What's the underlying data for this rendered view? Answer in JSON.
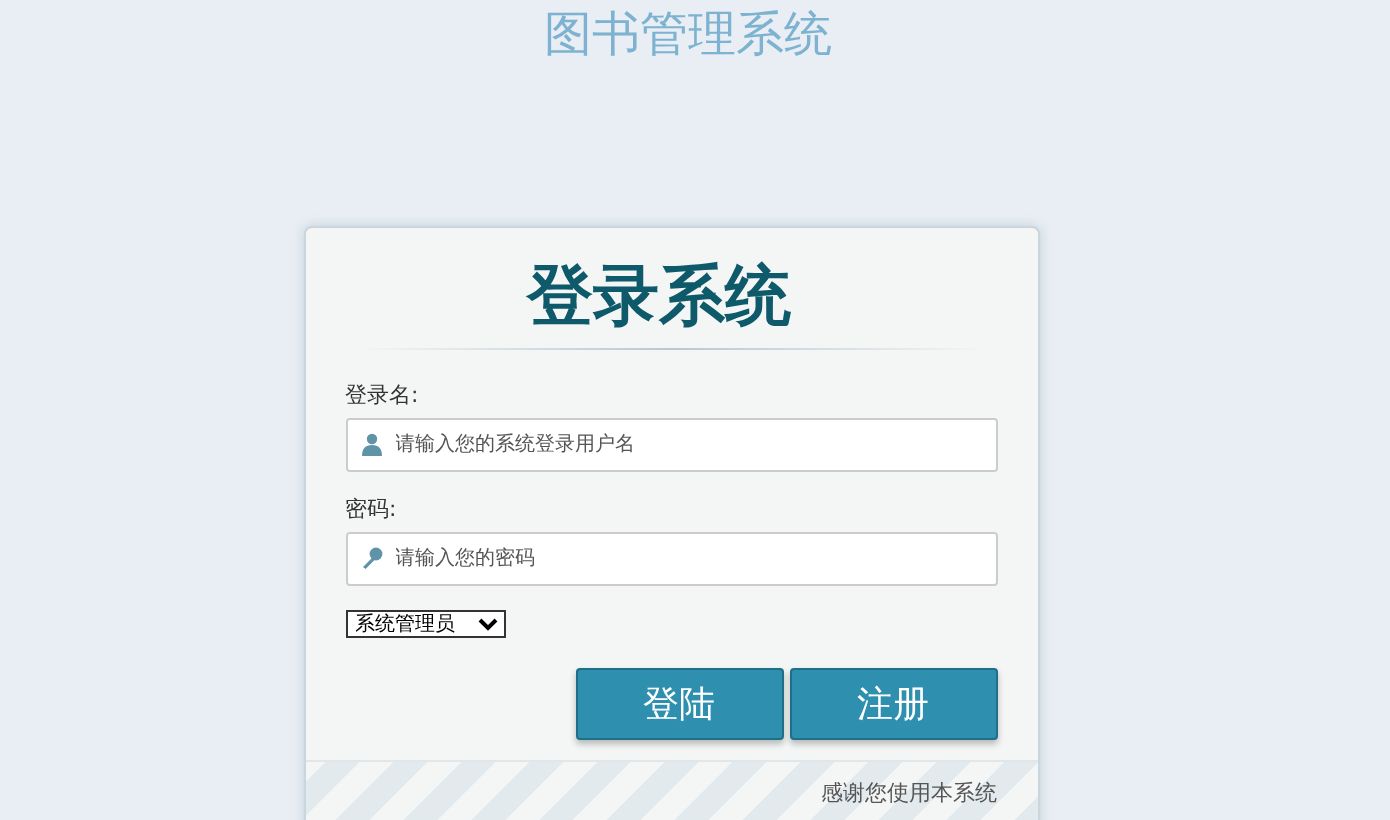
{
  "page_title": "图书管理系统",
  "login_card": {
    "heading": "登录系统",
    "fields": [
      {
        "label": "登录名:",
        "placeholder": "请输入您的系统登录用户名",
        "kind": "user"
      },
      {
        "label": "密码:",
        "placeholder": "请输入您的密码",
        "kind": "password"
      }
    ],
    "role": {
      "value": "系统管理员"
    },
    "buttons": [
      "登陆",
      "注册"
    ],
    "footer": "感谢您使用本系统"
  }
}
